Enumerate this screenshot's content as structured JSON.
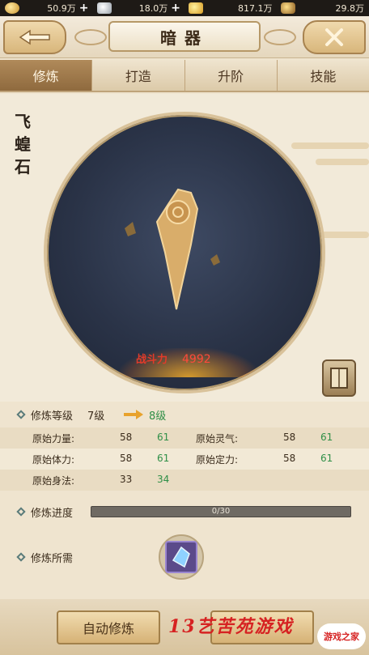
{
  "currencies": [
    {
      "icon": "copper-coin-icon",
      "value": "50.9万"
    },
    {
      "icon": "silver-ingot-icon",
      "value": "18.0万"
    },
    {
      "icon": "gold-ingot-icon",
      "value": "817.1万"
    },
    {
      "icon": "treasure-pot-icon",
      "value": "29.8万"
    }
  ],
  "header": {
    "title": "暗器"
  },
  "tabs": [
    {
      "label": "修炼",
      "active": true
    },
    {
      "label": "打造",
      "active": false
    },
    {
      "label": "升阶",
      "active": false
    },
    {
      "label": "技能",
      "active": false
    }
  ],
  "weapon": {
    "name": "飞蝗石",
    "power_label": "战斗力",
    "power_value": "4992"
  },
  "level": {
    "label": "修炼等级",
    "current": "7级",
    "next": "8级"
  },
  "stats": [
    [
      {
        "name": "原始力量:",
        "value": "58",
        "next": "61"
      },
      {
        "name": "原始灵气:",
        "value": "58",
        "next": "61"
      }
    ],
    [
      {
        "name": "原始体力:",
        "value": "58",
        "next": "61"
      },
      {
        "name": "原始定力:",
        "value": "58",
        "next": "61"
      }
    ],
    [
      {
        "name": "原始身法:",
        "value": "33",
        "next": "34"
      }
    ]
  ],
  "progress": {
    "label": "修炼进度",
    "text": "0/30",
    "fraction": 0
  },
  "requirement": {
    "label": "修炼所需"
  },
  "buttons": {
    "auto": "自动修炼"
  },
  "colors": {
    "accent_green": "#2f8f47",
    "power_red": "#ff4a3a",
    "tab_active": "#9a7546"
  }
}
